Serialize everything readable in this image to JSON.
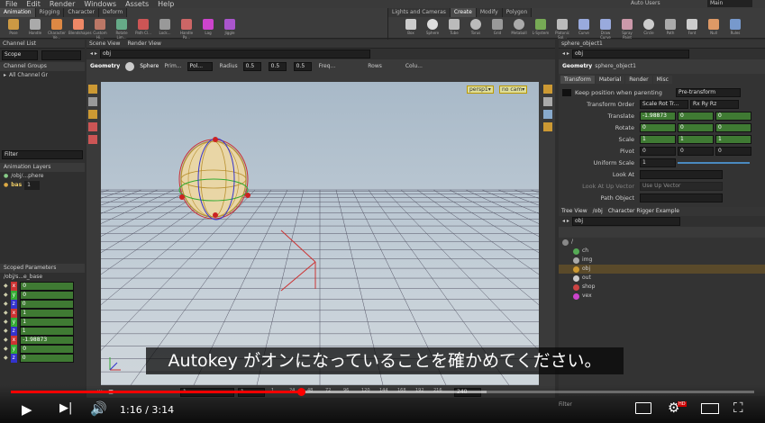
{
  "menu": [
    "File",
    "Edit",
    "Render",
    "Windows",
    "Assets",
    "Help"
  ],
  "top_right": {
    "autousers": "Auto Users",
    "context": "Main"
  },
  "shelf_tabs_left": [
    "Animation",
    "Rigging",
    "Character",
    "Deform"
  ],
  "shelf_tabs_right": [
    "Lights and Cameras",
    "Create",
    "Modify",
    "Polygon"
  ],
  "tools_left": [
    "Pose",
    "Handle",
    "Character Ve...",
    "Blendshapes",
    "Custom Hi...",
    "Rotate Lim...",
    "Path Cl...",
    "Lock...",
    "Handle Pa...",
    "Lag",
    "Jiggle"
  ],
  "tools_right": [
    "Box",
    "Sphere",
    "Tube",
    "Torus",
    "Grid",
    "Metaball",
    "L-System",
    "Platonic Sol...",
    "Curve",
    "Draw Curve",
    "Spray Paint",
    "Circle",
    "Path",
    "Font",
    "Null",
    "Rules"
  ],
  "left": {
    "channel_list": "Channel List",
    "scope": "Scope",
    "channel_groups": "Channel Groups",
    "all_channels": "All Channel Gr",
    "filter": "Filter",
    "anim_layers": "Animation Layers",
    "layer_obj": "/obj/...phere",
    "layer_base": "bas",
    "layer_base_val": "1",
    "scoped_params": "Scoped Parameters",
    "scoped_path": "/obj/s...e_base",
    "params": [
      {
        "c": "x",
        "v": "0"
      },
      {
        "c": "y",
        "v": "0"
      },
      {
        "c": "z",
        "v": "0"
      },
      {
        "c": "x",
        "v": "1"
      },
      {
        "c": "y",
        "v": "1"
      },
      {
        "c": "z",
        "v": "1"
      },
      {
        "c": "x",
        "v": "-1.98873"
      },
      {
        "c": "y",
        "v": "0"
      },
      {
        "c": "z",
        "v": "0"
      }
    ]
  },
  "viewport": {
    "tabs": [
      "Scene View",
      "Render View"
    ],
    "path": "obj",
    "op": "Geometry",
    "prim": "Sphere",
    "prim_lab": "Prim...",
    "poly": "Pol...",
    "radius_label": "Radius",
    "radius": [
      "0.5",
      "0.5",
      "0.5"
    ],
    "freq": "Freq...",
    "rows": "Rows",
    "cols": "Colu...",
    "persp": "persp1▾",
    "cam": "no cam▾"
  },
  "right": {
    "tab": "sphere_object1",
    "path": "obj",
    "op_type": "Geometry",
    "op_name": "sphere_object1",
    "ptabs": [
      "Transform",
      "Material",
      "Render",
      "Misc"
    ],
    "keep_label": "Keep position when parenting",
    "keep_val": "Pre-transform",
    "order_label": "Transform Order",
    "order1": "Scale Rot Tr...",
    "order2": "Rx Ry Rz",
    "translate_label": "Translate",
    "translate": [
      "-1.98873",
      "0",
      "0"
    ],
    "rotate_label": "Rotate",
    "rotate": [
      "0",
      "0",
      "0"
    ],
    "scale_label": "Scale",
    "scale": [
      "1",
      "1",
      "1"
    ],
    "pivot_label": "Pivot",
    "pivot": [
      "0",
      "0",
      "0"
    ],
    "uniform_label": "Uniform Scale",
    "uniform": "1",
    "lookat_label": "Look At",
    "lookup_label": "Look At Up Vector",
    "lookup_val": "Use Up Vector",
    "pathobj_label": "Path Object",
    "tree_tabs": [
      "Tree View",
      "/obj",
      "Character Rigger Example"
    ],
    "tree_path": "obj",
    "nodes": [
      "/",
      "ch",
      "img",
      "obj",
      "out",
      "shop",
      "vex"
    ]
  },
  "timeline": {
    "start": "1",
    "current": "1",
    "end": "240",
    "ticks": [
      "1",
      "24",
      "48",
      "72",
      "96",
      "120",
      "144",
      "168",
      "192",
      "216"
    ]
  },
  "caption": "Autokey がオンになっていることを確かめてください。",
  "player": {
    "time": "1:16 / 3:14",
    "progress": 0.39,
    "buffered": 0.64,
    "filter": "Filter"
  }
}
